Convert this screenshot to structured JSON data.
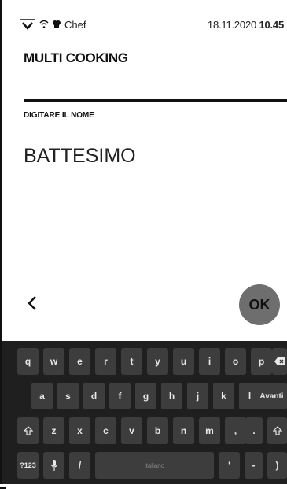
{
  "status_bar": {
    "app_label": "Chef",
    "date": "18.11.2020",
    "time": "10.45"
  },
  "page": {
    "title": "MULTI COOKING",
    "field_label": "DIGITARE IL NOME",
    "field_value": "BATTESIMO"
  },
  "actions": {
    "back_icon": "chevron-left-icon",
    "ok_label": "OK"
  },
  "keyboard": {
    "row1": [
      "q",
      "w",
      "e",
      "r",
      "t",
      "y",
      "u",
      "i",
      "o",
      "p"
    ],
    "row1_sub": [
      "",
      "",
      "",
      "",
      "",
      "",
      "",
      "",
      "",
      ""
    ],
    "row2": [
      "a",
      "s",
      "d",
      "f",
      "g",
      "h",
      "j",
      "k",
      "l"
    ],
    "enter_label": "Avanti",
    "row3": [
      "z",
      "x",
      "c",
      "v",
      "b",
      "n",
      "m",
      ",",
      "."
    ],
    "symbols_label": "?123",
    "slash_label": "/",
    "space_label": "italiano",
    "apostrophe_label": "'",
    "dash_label": "-",
    "paren_label": ")"
  },
  "colors": {
    "keyboard_bg": "#1f1f1f",
    "key_bg": "#3d3d3d",
    "ok_button_bg": "#6e6e6e"
  }
}
